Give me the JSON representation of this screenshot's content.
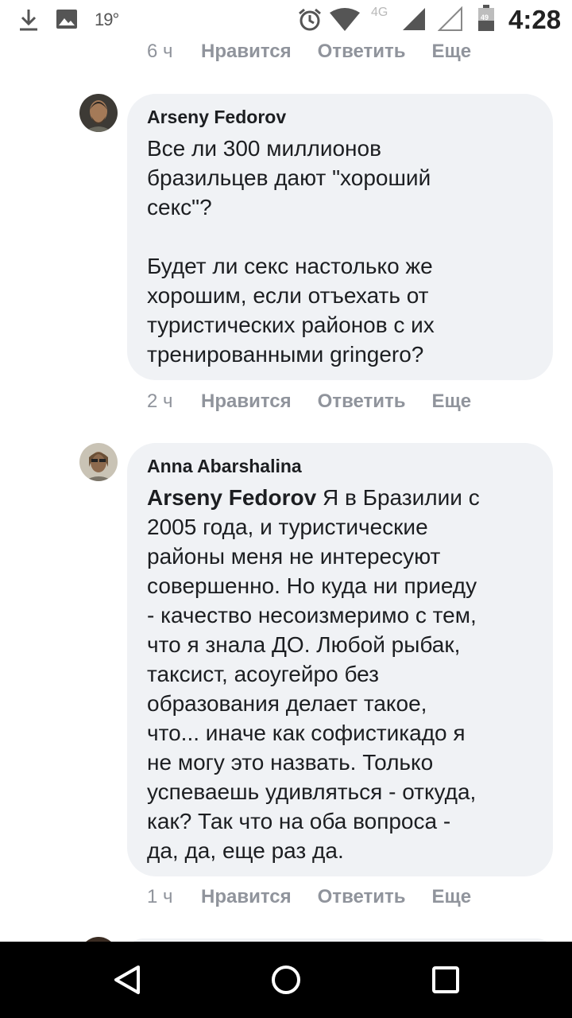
{
  "status_bar": {
    "temperature": "19°",
    "network": "4G",
    "battery": "49",
    "time": "4:28",
    "icons": [
      "download-icon",
      "image-icon",
      "alarm-icon",
      "wifi-icon",
      "signal-icon",
      "signal-empty-icon",
      "battery-icon"
    ]
  },
  "comments": [
    {
      "actions": {
        "time": "6 ч",
        "like": "Нравится",
        "reply": "Ответить",
        "more": "Еще"
      }
    },
    {
      "author": "Arseny Fedorov",
      "text": "Все ли 300 миллионов\nбразильцев дают \"хороший\nсекс\"?\n\nБудет ли секс настолько же\nхорошим, если отъехать от\nтуристических районов с их\nтренированными gringero?",
      "actions": {
        "time": "2 ч",
        "like": "Нравится",
        "reply": "Ответить",
        "more": "Еще"
      }
    },
    {
      "author": "Anna Abarshalina",
      "mention": "Arseny Fedorov",
      "text": " Я в Бразилии с\n2005 года, и туристические\nрайоны меня не интересуют\nсовершенно. Но куда ни приеду\n- качество несоизмеримо с тем,\nчто я знала ДО. Любой рыбак,\nтаксист, асоугейро без\nобразования делает такое,\nчто... иначе как софистикадо я\nне могу это назвать. Только\nуспеваешь удивляться - откуда,\nкак? Так что на оба вопроса -\nда, да, еще раз да.",
      "actions": {
        "time": "1 ч",
        "like": "Нравится",
        "reply": "Ответить",
        "more": "Еще"
      }
    }
  ],
  "nav_bar": {
    "icons": [
      "back-icon",
      "home-icon",
      "recents-icon"
    ]
  }
}
